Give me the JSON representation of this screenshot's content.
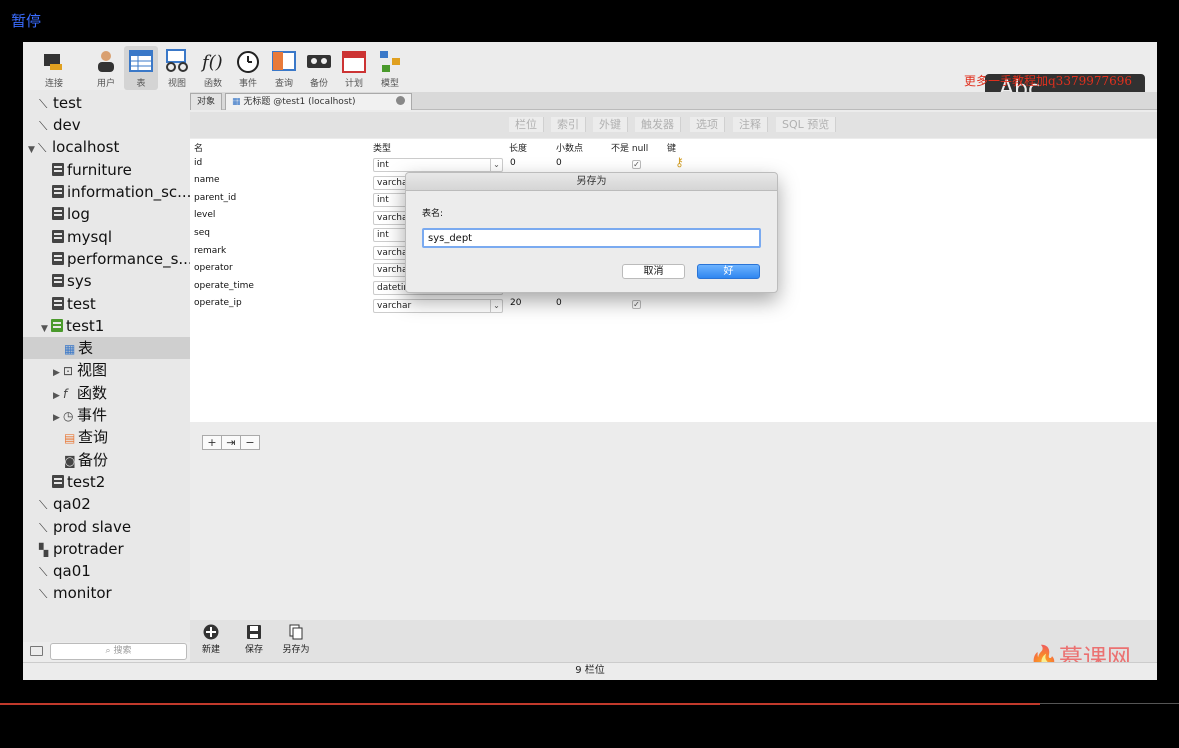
{
  "overlay": {
    "pause_label": "暂停",
    "watermark": "更多一手教程加q3379977696",
    "badge": "Abc",
    "logo": "慕课网"
  },
  "toolbar": {
    "items": [
      {
        "label": "连接",
        "icon": "connection-icon"
      },
      {
        "label": "用户",
        "icon": "user-icon"
      },
      {
        "label": "表",
        "icon": "table-icon"
      },
      {
        "label": "视图",
        "icon": "view-icon"
      },
      {
        "label": "函数",
        "icon": "function-icon"
      },
      {
        "label": "事件",
        "icon": "event-icon"
      },
      {
        "label": "查询",
        "icon": "query-icon"
      },
      {
        "label": "备份",
        "icon": "backup-icon"
      },
      {
        "label": "计划",
        "icon": "schedule-icon"
      },
      {
        "label": "模型",
        "icon": "model-icon"
      }
    ]
  },
  "sidebar": {
    "items": [
      {
        "label": "test"
      },
      {
        "label": "dev"
      },
      {
        "label": "localhost"
      },
      {
        "label": "furniture"
      },
      {
        "label": "information_sc..."
      },
      {
        "label": "log"
      },
      {
        "label": "mysql"
      },
      {
        "label": "performance_s..."
      },
      {
        "label": "sys"
      },
      {
        "label": "test"
      },
      {
        "label": "test1"
      },
      {
        "label": "表"
      },
      {
        "label": "视图"
      },
      {
        "label": "函数"
      },
      {
        "label": "事件"
      },
      {
        "label": "查询"
      },
      {
        "label": "备份"
      },
      {
        "label": "test2"
      },
      {
        "label": "qa02"
      },
      {
        "label": "prod slave"
      },
      {
        "label": "protrader"
      },
      {
        "label": "qa01"
      },
      {
        "label": "monitor"
      }
    ],
    "search_placeholder": "搜索"
  },
  "tabs": {
    "objects": "对象",
    "untitled": "无标题 @test1 (localhost)"
  },
  "subtabs": [
    "栏位",
    "索引",
    "外键",
    "触发器",
    "选项",
    "注释",
    "SQL 预览"
  ],
  "grid": {
    "headers": {
      "name": "名",
      "type": "类型",
      "length": "长度",
      "decimals": "小数点",
      "not_null": "不是 null",
      "key": "键"
    },
    "rows": [
      {
        "name": "id",
        "type": "int",
        "length": "0",
        "decimals": "0"
      },
      {
        "name": "name",
        "type": "varchar"
      },
      {
        "name": "parent_id",
        "type": "int"
      },
      {
        "name": "level",
        "type": "varchar"
      },
      {
        "name": "seq",
        "type": "int"
      },
      {
        "name": "remark",
        "type": "varchar"
      },
      {
        "name": "operator",
        "type": "varchar"
      },
      {
        "name": "operate_time",
        "type": "datetime"
      },
      {
        "name": "operate_ip",
        "type": "varchar",
        "length": "20",
        "decimals": "0"
      }
    ]
  },
  "bottom": {
    "new": "新建",
    "save": "保存",
    "save_as": "另存为"
  },
  "status": "9 栏位",
  "dialog": {
    "title": "另存为",
    "label": "表名:",
    "value": "sys_dept",
    "cancel": "取消",
    "ok": "好"
  }
}
